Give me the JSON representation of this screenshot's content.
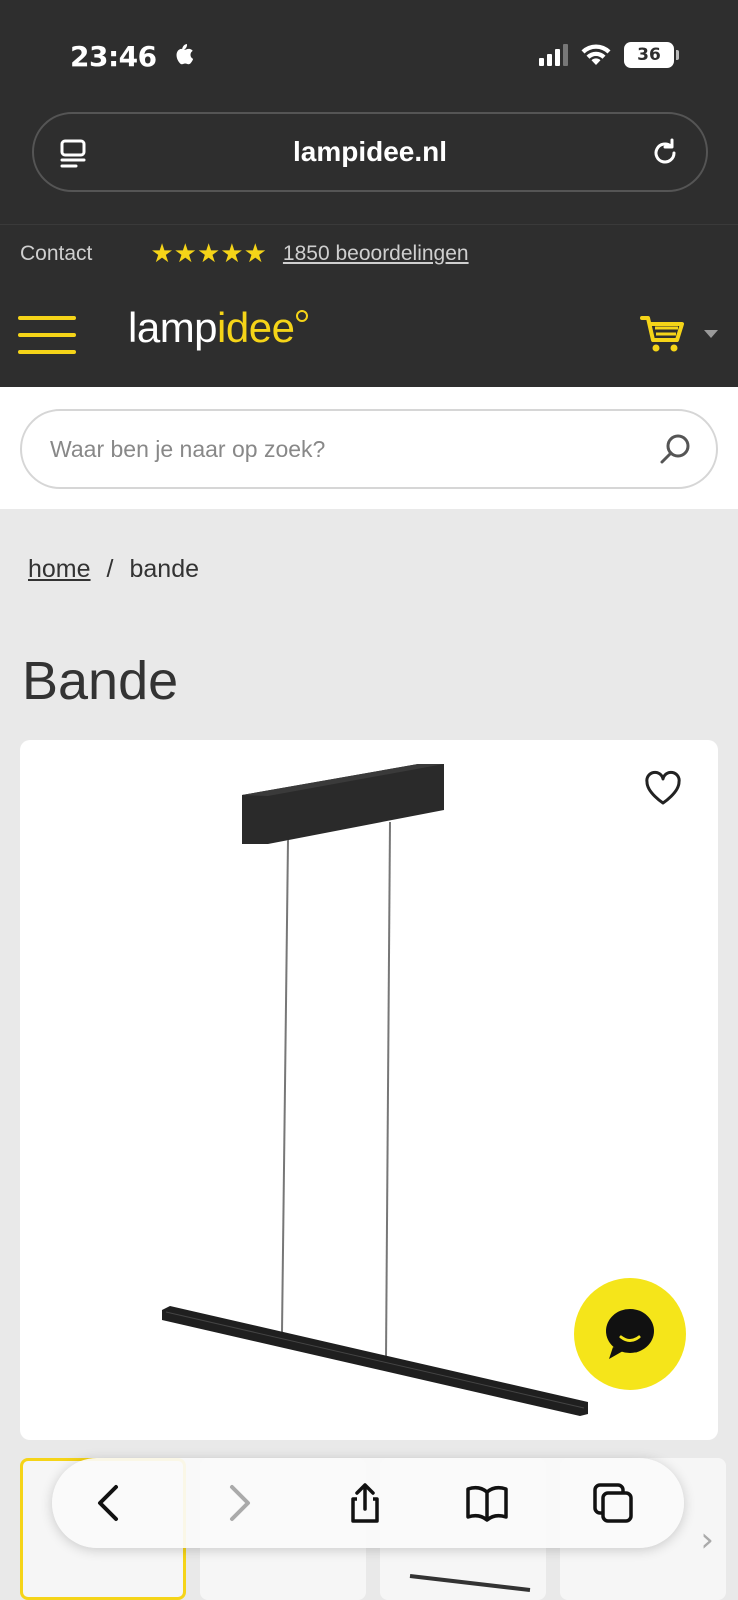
{
  "status_bar": {
    "time": "23:46",
    "battery": "36"
  },
  "url_bar": {
    "domain": "lampidee.nl"
  },
  "info_bar": {
    "contact_label": "Contact",
    "stars": "★★★★★",
    "reviews_label": "1850 beoordelingen"
  },
  "header": {
    "logo_part1": "lamp",
    "logo_part2": "idee",
    "accent_color": "#f5d418",
    "background_color": "#2e2e2e"
  },
  "search": {
    "placeholder": "Waar ben je naar op zoek?"
  },
  "breadcrumb": {
    "home": "home",
    "separator": "/",
    "current": "bande"
  },
  "page": {
    "title": "Bande"
  },
  "product": {
    "image_icon": "pendant-lamp-image",
    "favorite_icon": "heart-icon",
    "chat_icon": "chat-bubble-icon"
  },
  "safari_toolbar": {
    "icons": [
      "back-icon",
      "forward-icon",
      "share-icon",
      "bookmarks-icon",
      "tabs-icon"
    ]
  }
}
